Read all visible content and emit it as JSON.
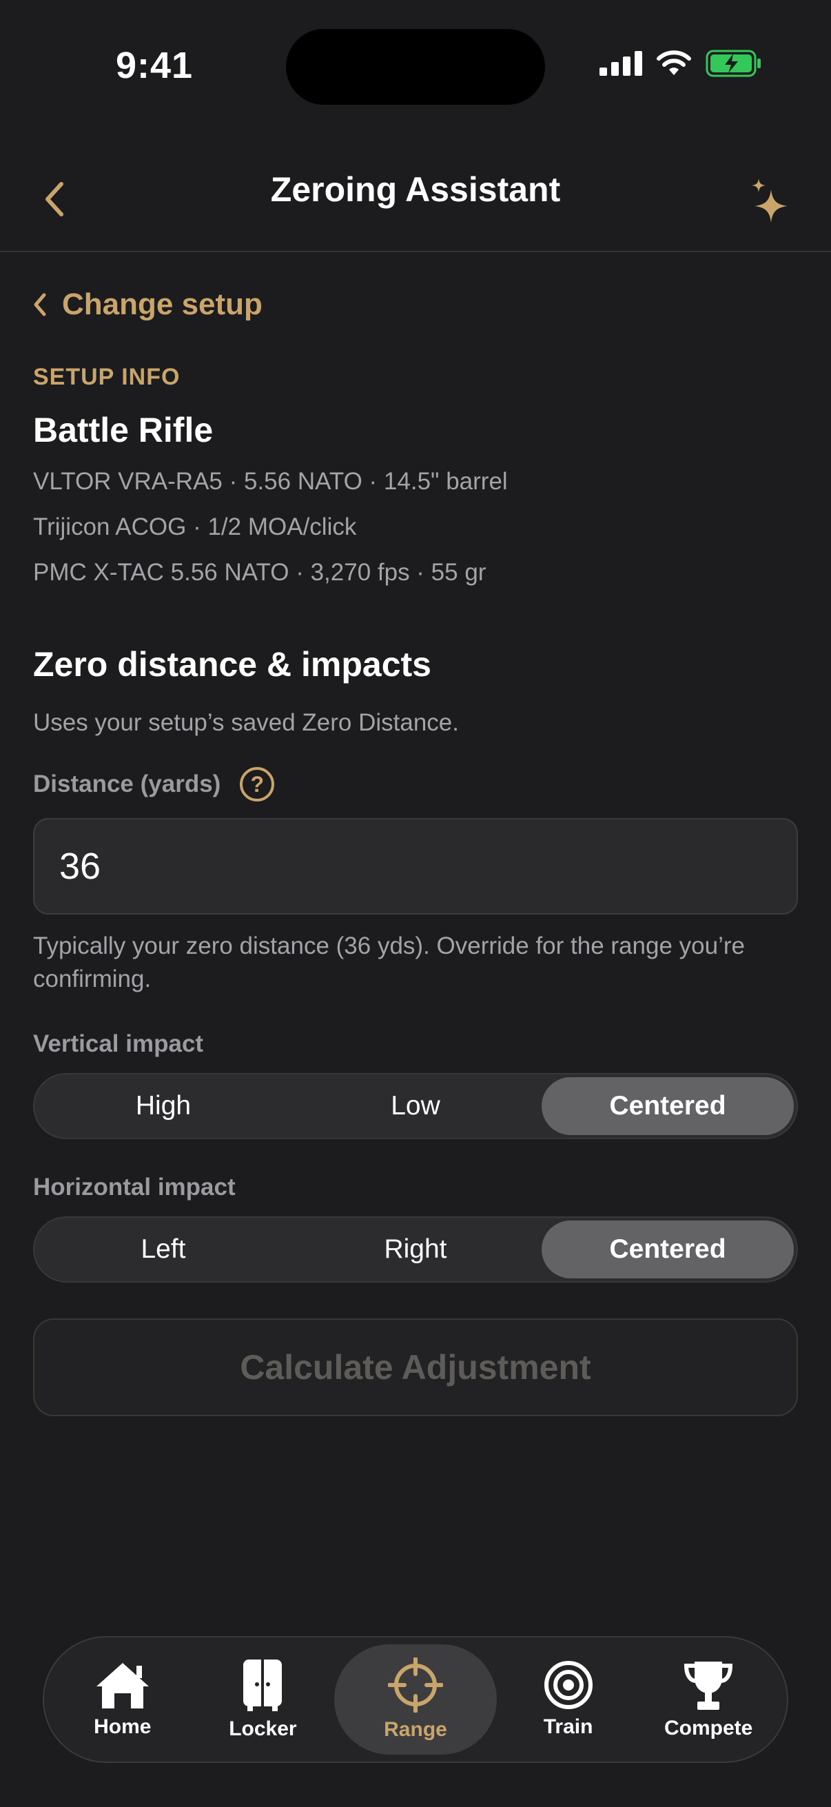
{
  "status": {
    "time": "9:41"
  },
  "header": {
    "title": "Zeroing Assistant"
  },
  "back_link": {
    "label": "Change setup"
  },
  "setup": {
    "eyebrow": "SETUP INFO",
    "name": "Battle Rifle",
    "specs": [
      "VLTOR VRA-RA5 · 5.56 NATO · 14.5\" barrel",
      "Trijicon ACOG · 1/2 MOA/click",
      "PMC X-TAC 5.56 NATO · 3,270 fps · 55 gr"
    ]
  },
  "zero": {
    "title": "Zero distance & impacts",
    "subtitle": "Uses your setup’s saved Zero Distance.",
    "distance_label": "Distance (yards)",
    "distance_value": "36",
    "hint": "Typically your zero distance (36 yds). Override for the range you’re confirming.",
    "vertical": {
      "label": "Vertical impact",
      "options": [
        "High",
        "Low",
        "Centered"
      ],
      "selected": "Centered"
    },
    "horizontal": {
      "label": "Horizontal impact",
      "options": [
        "Left",
        "Right",
        "Centered"
      ],
      "selected": "Centered"
    },
    "calculate_label": "Calculate Adjustment"
  },
  "tabs": [
    {
      "label": "Home",
      "icon": "house-icon"
    },
    {
      "label": "Locker",
      "icon": "locker-icon"
    },
    {
      "label": "Range",
      "icon": "crosshair-icon",
      "active": true
    },
    {
      "label": "Train",
      "icon": "target-icon"
    },
    {
      "label": "Compete",
      "icon": "trophy-icon"
    }
  ],
  "colors": {
    "accent": "#c9a56b",
    "background": "#1c1c1e",
    "battery": "#34c759"
  }
}
